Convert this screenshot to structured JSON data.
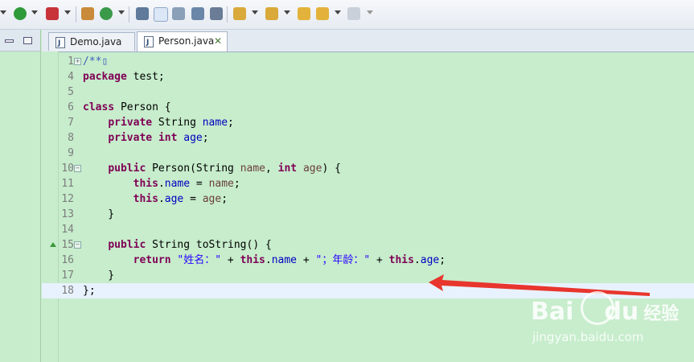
{
  "editor": {
    "tabs": [
      {
        "label": "Demo.java",
        "active": false
      },
      {
        "label": "Person.java",
        "active": true
      }
    ]
  },
  "code": {
    "lines": [
      {
        "num": "1",
        "fold": "+",
        "tokens": [
          {
            "t": "/**",
            "c": "cmt"
          },
          {
            "t": "▯",
            "c": "cmt"
          }
        ]
      },
      {
        "num": "4",
        "tokens": [
          {
            "t": "package",
            "c": "kw"
          },
          {
            "t": " test;"
          }
        ]
      },
      {
        "num": "5",
        "tokens": []
      },
      {
        "num": "6",
        "tokens": [
          {
            "t": "class",
            "c": "kw"
          },
          {
            "t": " Person {"
          }
        ]
      },
      {
        "num": "7",
        "tokens": [
          {
            "t": "    "
          },
          {
            "t": "private",
            "c": "kw"
          },
          {
            "t": " String "
          },
          {
            "t": "name",
            "c": "fld"
          },
          {
            "t": ";"
          }
        ]
      },
      {
        "num": "8",
        "tokens": [
          {
            "t": "    "
          },
          {
            "t": "private",
            "c": "kw"
          },
          {
            "t": " "
          },
          {
            "t": "int",
            "c": "kw"
          },
          {
            "t": " "
          },
          {
            "t": "age",
            "c": "fld"
          },
          {
            "t": ";"
          }
        ]
      },
      {
        "num": "9",
        "tokens": []
      },
      {
        "num": "10",
        "fold": "−",
        "tokens": [
          {
            "t": "    "
          },
          {
            "t": "public",
            "c": "kw"
          },
          {
            "t": " Person(String "
          },
          {
            "t": "name",
            "c": "par"
          },
          {
            "t": ", "
          },
          {
            "t": "int",
            "c": "kw"
          },
          {
            "t": " "
          },
          {
            "t": "age",
            "c": "par"
          },
          {
            "t": ") {"
          }
        ]
      },
      {
        "num": "11",
        "tokens": [
          {
            "t": "        "
          },
          {
            "t": "this",
            "c": "kw"
          },
          {
            "t": "."
          },
          {
            "t": "name",
            "c": "fld"
          },
          {
            "t": " = "
          },
          {
            "t": "name",
            "c": "par"
          },
          {
            "t": ";"
          }
        ]
      },
      {
        "num": "12",
        "tokens": [
          {
            "t": "        "
          },
          {
            "t": "this",
            "c": "kw"
          },
          {
            "t": "."
          },
          {
            "t": "age",
            "c": "fld"
          },
          {
            "t": " = "
          },
          {
            "t": "age",
            "c": "par"
          },
          {
            "t": ";"
          }
        ]
      },
      {
        "num": "13",
        "tokens": [
          {
            "t": "    }"
          }
        ]
      },
      {
        "num": "14",
        "tokens": []
      },
      {
        "num": "15",
        "fold": "−",
        "marker": true,
        "tokens": [
          {
            "t": "    "
          },
          {
            "t": "public",
            "c": "kw"
          },
          {
            "t": " String toString() {"
          }
        ]
      },
      {
        "num": "16",
        "tokens": [
          {
            "t": "        "
          },
          {
            "t": "return",
            "c": "kw"
          },
          {
            "t": " "
          },
          {
            "t": "\"姓名：\"",
            "c": "str"
          },
          {
            "t": " + "
          },
          {
            "t": "this",
            "c": "kw"
          },
          {
            "t": "."
          },
          {
            "t": "name",
            "c": "fld"
          },
          {
            "t": " + "
          },
          {
            "t": "\"；年龄：\"",
            "c": "str"
          },
          {
            "t": " + "
          },
          {
            "t": "this",
            "c": "kw"
          },
          {
            "t": "."
          },
          {
            "t": "age",
            "c": "fld"
          },
          {
            "t": ";"
          }
        ]
      },
      {
        "num": "17",
        "tokens": [
          {
            "t": "    }"
          }
        ]
      },
      {
        "num": "18",
        "current": true,
        "tokens": [
          {
            "t": "};"
          }
        ]
      }
    ]
  },
  "colors": {
    "arrow": "#e8352d",
    "background": "#c7edcc"
  },
  "watermark": {
    "brand": "Bai",
    "brand2": "du",
    "cn": "经验",
    "url": "jingyan.baidu.com"
  }
}
